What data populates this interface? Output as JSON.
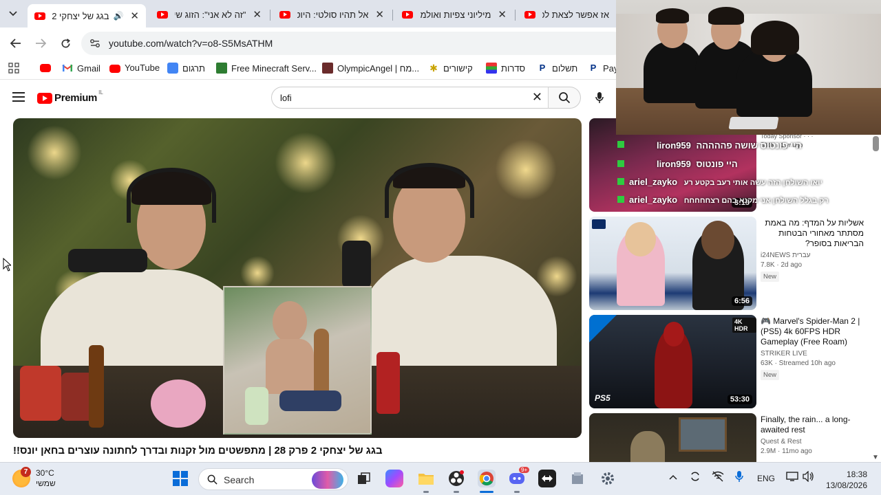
{
  "browser": {
    "tabs": [
      {
        "title": "בגג של יצחקי 2 פ",
        "active": true
      },
      {
        "title": "\"זה לא אני\": הזוג שי"
      },
      {
        "title": "אל תהיו סולטי: היוט"
      },
      {
        "title": "מיליוני צפיות ואולמו"
      },
      {
        "title": "אז אפשר לצאת לפנ"
      }
    ],
    "url": "youtube.com/watch?v=o8-S5MsATHM",
    "bookmarks": [
      {
        "label": "Gmail"
      },
      {
        "label": "YouTube"
      },
      {
        "label": "תרגום"
      },
      {
        "label": "Free Minecraft Serv..."
      },
      {
        "label": "OlympicAngel | מח..."
      },
      {
        "label": "קישורים"
      },
      {
        "label": "סדרות"
      },
      {
        "label": "תשלום"
      },
      {
        "label": "Payl"
      }
    ]
  },
  "youtube": {
    "logo_text": "Premium",
    "country_code": "IL",
    "search_value": "lofi",
    "video_title": "בגג של יצחקי 2 פרק 28 | מתפשטים מול זקנות ובדרך לחתונה עוצרים בחאן יונס!!"
  },
  "chat_overlay": {
    "rows": [
      {
        "name": "liron959",
        "text": "היי פונטוס שושה פההההה"
      },
      {
        "name": "liron959",
        "text": "היי פונטוס"
      },
      {
        "name": "ariel_zayko",
        "text": "יואו השולחן הזה עשה אותי רעב בקטע רע"
      },
      {
        "name": "ariel_zayko",
        "text": "רק בגלל השולחן אני מקנא בהם רצחחחחח"
      }
    ],
    "partial_meta_1": "Today Sponsor · · ·",
    "partial_meta_2": "534K · 1 yr ago"
  },
  "recommendations": [
    {
      "duration": "3:13"
    },
    {
      "title": "אשליות על המדף: מה באמת מסתתר מאחורי הבטחות הבריאות בסופר?",
      "channel": "i24NEWS עברית",
      "meta": "7.8K · 2d ago",
      "badge": "New",
      "duration": "6:56"
    },
    {
      "title": "🎮 Marvel's Spider-Man 2 | (PS5) 4k 60FPS HDR Gameplay (Free Roam)",
      "channel": "STRIKER LIVE",
      "meta": "63K · Streamed 10h ago",
      "badge": "New",
      "duration": "53:30",
      "thumb_badge": "4K HDR",
      "thumb_logo": "PS5"
    },
    {
      "title": "Finally, the rain... a long-awaited rest",
      "channel": "Quest & Rest",
      "meta": "2.9M · 11mo ago"
    }
  ],
  "taskbar": {
    "weather_temp": "30°C",
    "weather_day": "שמשי",
    "weather_badge": "7",
    "search_placeholder": "Search",
    "discord_badge": "9+",
    "language": "ENG",
    "time": "18:38",
    "date": "13/08/2026"
  },
  "colors": {
    "youtube_red": "#ff0000",
    "tab_strip": "#dfe3eb",
    "taskbar": "#e6ebf3"
  }
}
